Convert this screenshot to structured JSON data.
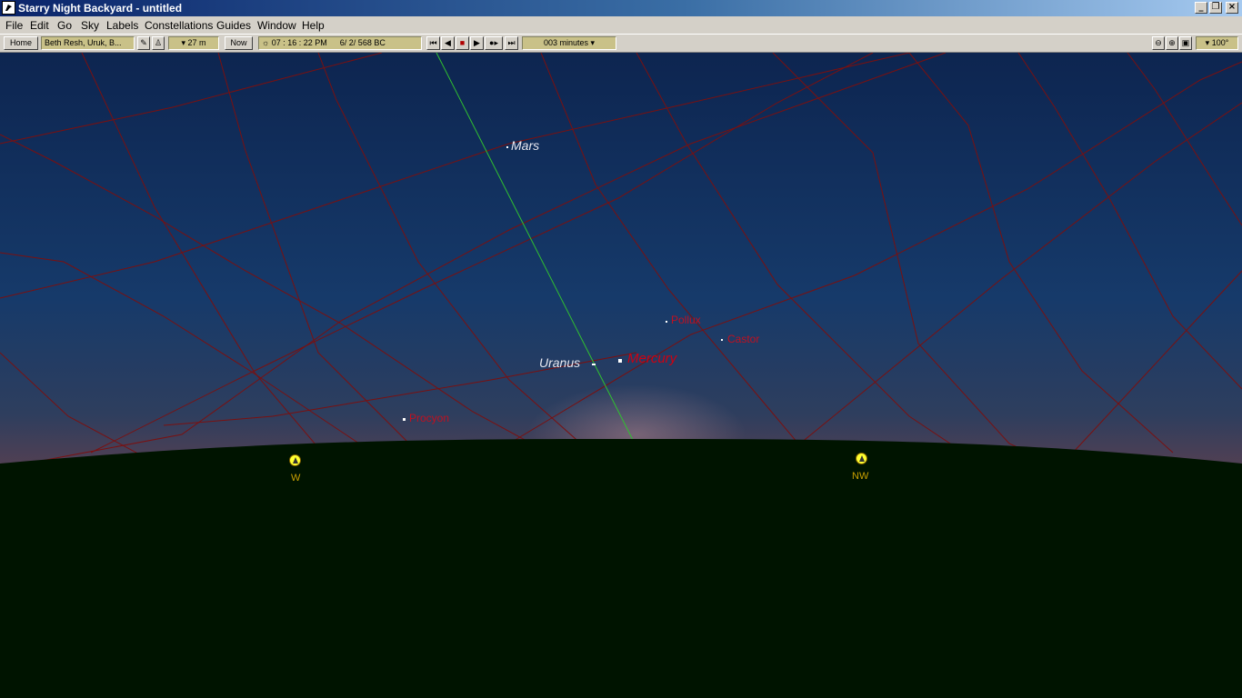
{
  "window": {
    "title": "Starry Night Backyard - untitled"
  },
  "menu": [
    "File",
    "Edit",
    "Go",
    "Sky",
    "Labels",
    "Constellations",
    "Guides",
    "Window",
    "Help"
  ],
  "toolbar": {
    "home_label": "Home",
    "location": "Beth Resh, Uruk, B...",
    "elevation": "27 m",
    "now_label": "Now",
    "time": "07 : 16 : 22 PM",
    "date": "6/  2/  568 BC",
    "time_step": "003 minutes",
    "zoom": "100°"
  },
  "sky": {
    "objects": [
      {
        "name": "Mars",
        "color": "#e8e8f0"
      },
      {
        "name": "Uranus",
        "color": "#e8e8f0"
      },
      {
        "name": "Mercury",
        "color": "#d00010"
      },
      {
        "name": "Pollux",
        "color": "#c01020"
      },
      {
        "name": "Castor",
        "color": "#c01020"
      },
      {
        "name": "Procyon",
        "color": "#c01020"
      }
    ],
    "compass": [
      {
        "label": "W"
      },
      {
        "label": "NW"
      }
    ]
  },
  "colors": {
    "sky_top": "#0d2550",
    "sky_horizon": "#5a4050",
    "ground": "#001400",
    "grid_line": "#7a1010",
    "ecliptic": "#30c030"
  }
}
